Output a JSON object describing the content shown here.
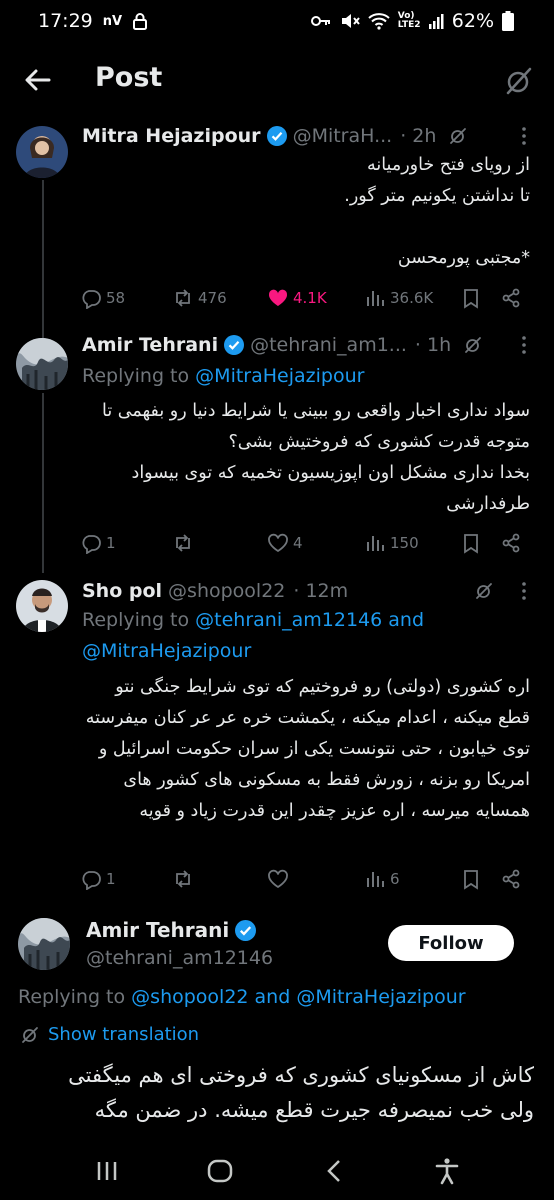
{
  "status_bar": {
    "time": "17:29",
    "carrier_mark": "nV",
    "volte": "Vo) LTE2",
    "battery": "62%"
  },
  "header": {
    "title": "Post"
  },
  "tweets": [
    {
      "name": "Mitra Hejazipour",
      "handle": "@MitraH...",
      "time": "· 2h",
      "body": "از رویای فتح خاورمیانه\nتا نداشتن یکونیم متر گور.\n\n*مجتبی پورمحسن",
      "stats": {
        "replies": "58",
        "reposts": "476",
        "likes": "4.1K",
        "views": "36.6K"
      }
    },
    {
      "name": "Amir Tehrani",
      "handle": "@tehrani_am1...",
      "time": "· 1h",
      "replying_prefix": "Replying to",
      "replying_to": "@MitraHejazipour",
      "body": "سواد نداری اخبار واقعی رو ببینی یا شرایط دنیا رو بفهمی تا متوجه قدرت کشوری که فروختیش بشی؟\nبخدا نداری مشکل اون اپوزیسیون تخمیه که توی بیسواد طرفدارشی",
      "stats": {
        "replies": "1",
        "reposts": "",
        "likes": "4",
        "views": "150"
      }
    },
    {
      "name": "Sho pol",
      "handle": "@shopool22",
      "time": "· 12m",
      "replying_prefix": "Replying to",
      "replying_to": "@tehrani_am12146 and",
      "replying_to_2": "@MitraHejazipour",
      "body": "اره کشوری (دولتی) رو فروختیم که توی شرایط جنگی نتو قطع میکنه ، اعدام میکنه ، یکمشت خره عر عر کنان میفرسته توی خیابون ، حتی نتونست یکی از سران حکومت اسرائیل و امریکا رو بزنه ، زورش فقط به مسکونی های کشور های همسایه میرسه ، اره عزیز چقدر این قدرت زیاد و قویه",
      "stats": {
        "replies": "1",
        "reposts": "",
        "likes": "",
        "views": "6"
      }
    }
  ],
  "focus_tweet": {
    "name": "Amir Tehrani",
    "handle": "@tehrani_am12146",
    "follow_label": "Follow",
    "replying_prefix": "Replying to",
    "replying_to": "@shopool22 and @MitraHejazipour",
    "show_translation": "Show translation",
    "body": "کاش از مسکونیای کشوری که فروختی ای هم میگفتی\nولی خب نمیصرفه جیرت قطع میشه. در ضمن مگه"
  },
  "colors": {
    "background": "#000000",
    "text": "#e7e9ea",
    "muted": "#71767b",
    "link": "#1d9bf0",
    "verified": "#1d9bf0",
    "like_active": "#f91880"
  }
}
